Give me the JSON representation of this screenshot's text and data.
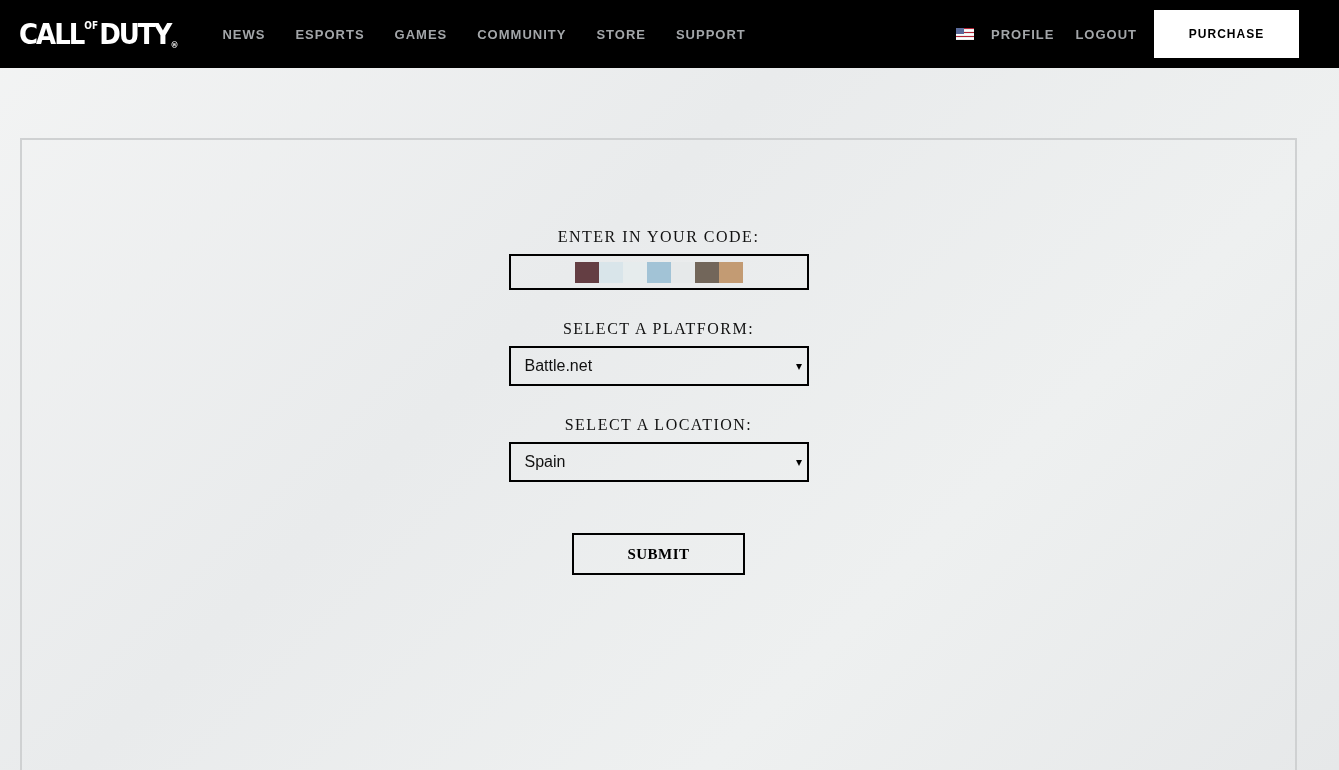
{
  "header": {
    "logo": {
      "left": "CALL",
      "small": "OF",
      "right": "DUTY",
      "mark": "®"
    },
    "nav": [
      {
        "label": "NEWS"
      },
      {
        "label": "ESPORTS"
      },
      {
        "label": "GAMES"
      },
      {
        "label": "COMMUNITY"
      },
      {
        "label": "STORE"
      },
      {
        "label": "SUPPORT"
      }
    ],
    "account": [
      {
        "label": "PROFILE"
      },
      {
        "label": "LOGOUT"
      }
    ],
    "purchase": "PURCHASE"
  },
  "form": {
    "code_label": "ENTER IN YOUR CODE:",
    "code_swatches": [
      {
        "color": "#643e43"
      },
      {
        "color": "#d9e5ea"
      },
      {
        "color": "#e6eced"
      },
      {
        "color": "#a2c3d6"
      },
      {
        "color": "#e6e9ea"
      },
      {
        "color": "#72665a"
      },
      {
        "color": "#c39b73"
      }
    ],
    "selects": [
      {
        "label": "SELECT A PLATFORM:",
        "value": "Battle.net",
        "arrow": "▾"
      },
      {
        "label": "SELECT A LOCATION:",
        "value": "Spain",
        "arrow": "▾"
      }
    ],
    "submit": "SUBMIT"
  }
}
